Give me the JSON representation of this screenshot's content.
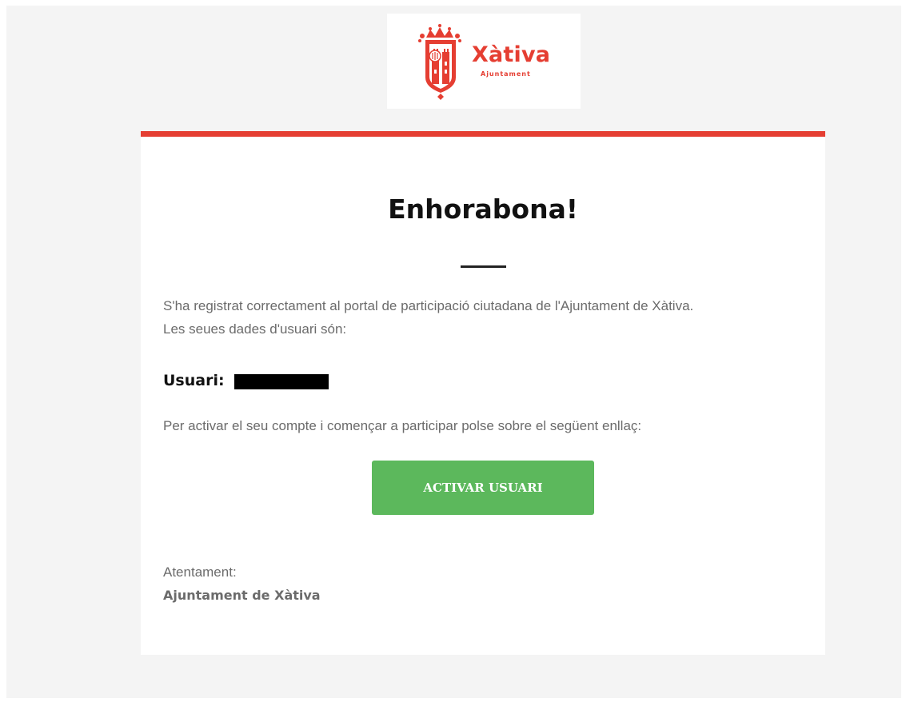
{
  "header": {
    "logo_title": "Xàtiva",
    "logo_subtitle": "Ajuntament"
  },
  "email": {
    "title": "Enhorabona!",
    "intro_line1": "S'ha registrat correctament al portal de participació ciutadana de l'Ajuntament de Xàtiva.",
    "intro_line2": "Les seues dades d'usuari són:",
    "user_label": "Usuari:",
    "activate_text": "Per activar el seu compte i començar a participar polse sobre el següent enllaç:",
    "button_label": "ACTIVAR USUARI",
    "signoff": "Atentament:",
    "signature": "Ajuntament de Xàtiva"
  },
  "colors": {
    "page_bg": "#f4f4f4",
    "accent_red": "#e53e32",
    "button_green": "#5cb85c",
    "body_text": "#6b6b6b",
    "heading": "#111111"
  },
  "icons": [
    "xativa-coat-of-arms-icon"
  ]
}
